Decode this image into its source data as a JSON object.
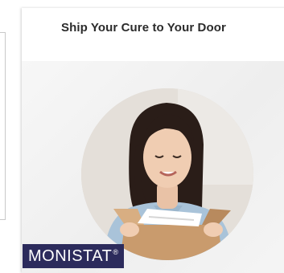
{
  "card": {
    "title": "Ship Your Cure to Your Door"
  },
  "brand": {
    "name": "MONISTAT",
    "mark": "®"
  },
  "colors": {
    "brand_bg": "#2c2b5c",
    "card_bg": "#f3f3f3",
    "title_text": "#2b2b2b"
  }
}
